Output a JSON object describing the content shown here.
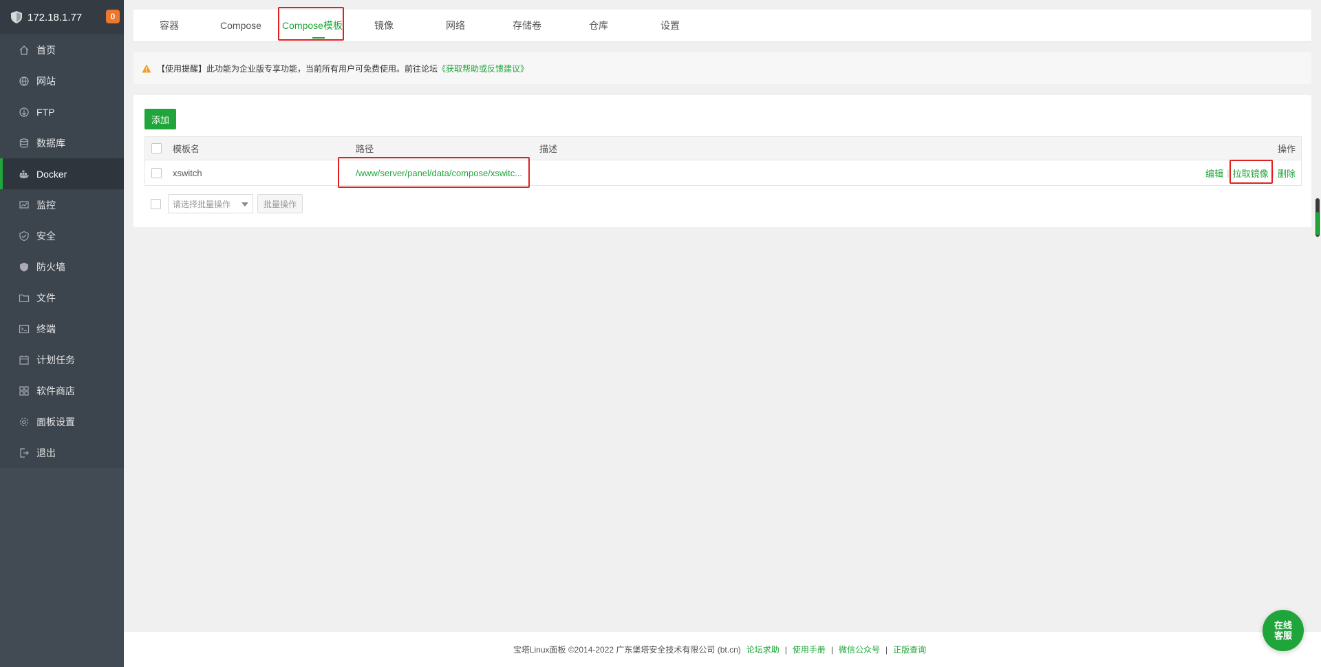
{
  "sidebar": {
    "host": "172.18.1.77",
    "badge": "0",
    "items": [
      {
        "label": "首页",
        "icon": "home-icon"
      },
      {
        "label": "网站",
        "icon": "globe-icon"
      },
      {
        "label": "FTP",
        "icon": "ftp-icon"
      },
      {
        "label": "数据库",
        "icon": "database-icon"
      },
      {
        "label": "Docker",
        "icon": "docker-icon",
        "active": true
      },
      {
        "label": "监控",
        "icon": "monitor-icon"
      },
      {
        "label": "安全",
        "icon": "security-icon"
      },
      {
        "label": "防火墙",
        "icon": "firewall-icon"
      },
      {
        "label": "文件",
        "icon": "folder-icon"
      },
      {
        "label": "终端",
        "icon": "terminal-icon"
      },
      {
        "label": "计划任务",
        "icon": "calendar-icon"
      },
      {
        "label": "软件商店",
        "icon": "apps-icon"
      },
      {
        "label": "面板设置",
        "icon": "settings-icon"
      },
      {
        "label": "退出",
        "icon": "logout-icon"
      }
    ]
  },
  "tabs": [
    {
      "label": "容器"
    },
    {
      "label": "Compose"
    },
    {
      "label": "Compose模板",
      "active": true
    },
    {
      "label": "镜像"
    },
    {
      "label": "网络"
    },
    {
      "label": "存储卷"
    },
    {
      "label": "仓库"
    },
    {
      "label": "设置"
    }
  ],
  "notice": {
    "text": "【使用提醒】此功能为企业版专享功能，当前所有用户可免费使用。前往论坛",
    "link": "《获取帮助或反馈建议》"
  },
  "panel": {
    "add_label": "添加",
    "columns": {
      "name": "模板名",
      "path": "路径",
      "desc": "描述",
      "ops": "操作"
    },
    "rows": [
      {
        "name": "xswitch",
        "path": "/www/server/panel/data/compose/xswitc...",
        "desc": ""
      }
    ],
    "ops": {
      "edit": "编辑",
      "pull": "拉取镜像",
      "delete": "删除"
    },
    "batch_placeholder": "请选择批量操作",
    "batch_button": "批量操作"
  },
  "footer": {
    "copyright": "宝塔Linux面板 ©2014-2022 广东堡塔安全技术有限公司 (bt.cn)",
    "links": [
      "论坛求助",
      "使用手册",
      "微信公众号",
      "正版查询"
    ]
  },
  "chat": {
    "line1": "在线",
    "line2": "客服"
  },
  "colors": {
    "accent": "#20a53a",
    "sidebar_bg": "#3c444d",
    "highlight": "#e02020",
    "badge": "#f0762c"
  }
}
